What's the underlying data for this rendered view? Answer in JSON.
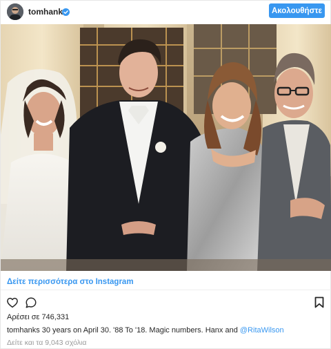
{
  "header": {
    "username": "tomhanks",
    "follow_label": "Ακολουθήστε"
  },
  "post": {
    "image_alt": "Couple at wedding beside life-size cutout of groom and present-day couple",
    "more_link": "Δείτε περισσότερα στο Instagram",
    "likes": "Αρέσει σε 746,331",
    "caption_user": "tomhanks",
    "caption_text": "30 years on April 30. '88 To '18. Magic numbers. Hanx and",
    "caption_mention": "@RitaWilson",
    "comments_link": "Δείτε και τα 9,043 σχόλια"
  },
  "colors": {
    "accent": "#3897f0",
    "muted": "#999999",
    "text": "#262626"
  },
  "icons": {
    "verified": "verified-badge-icon",
    "like": "heart-icon",
    "comment": "comment-icon",
    "save": "bookmark-icon"
  }
}
